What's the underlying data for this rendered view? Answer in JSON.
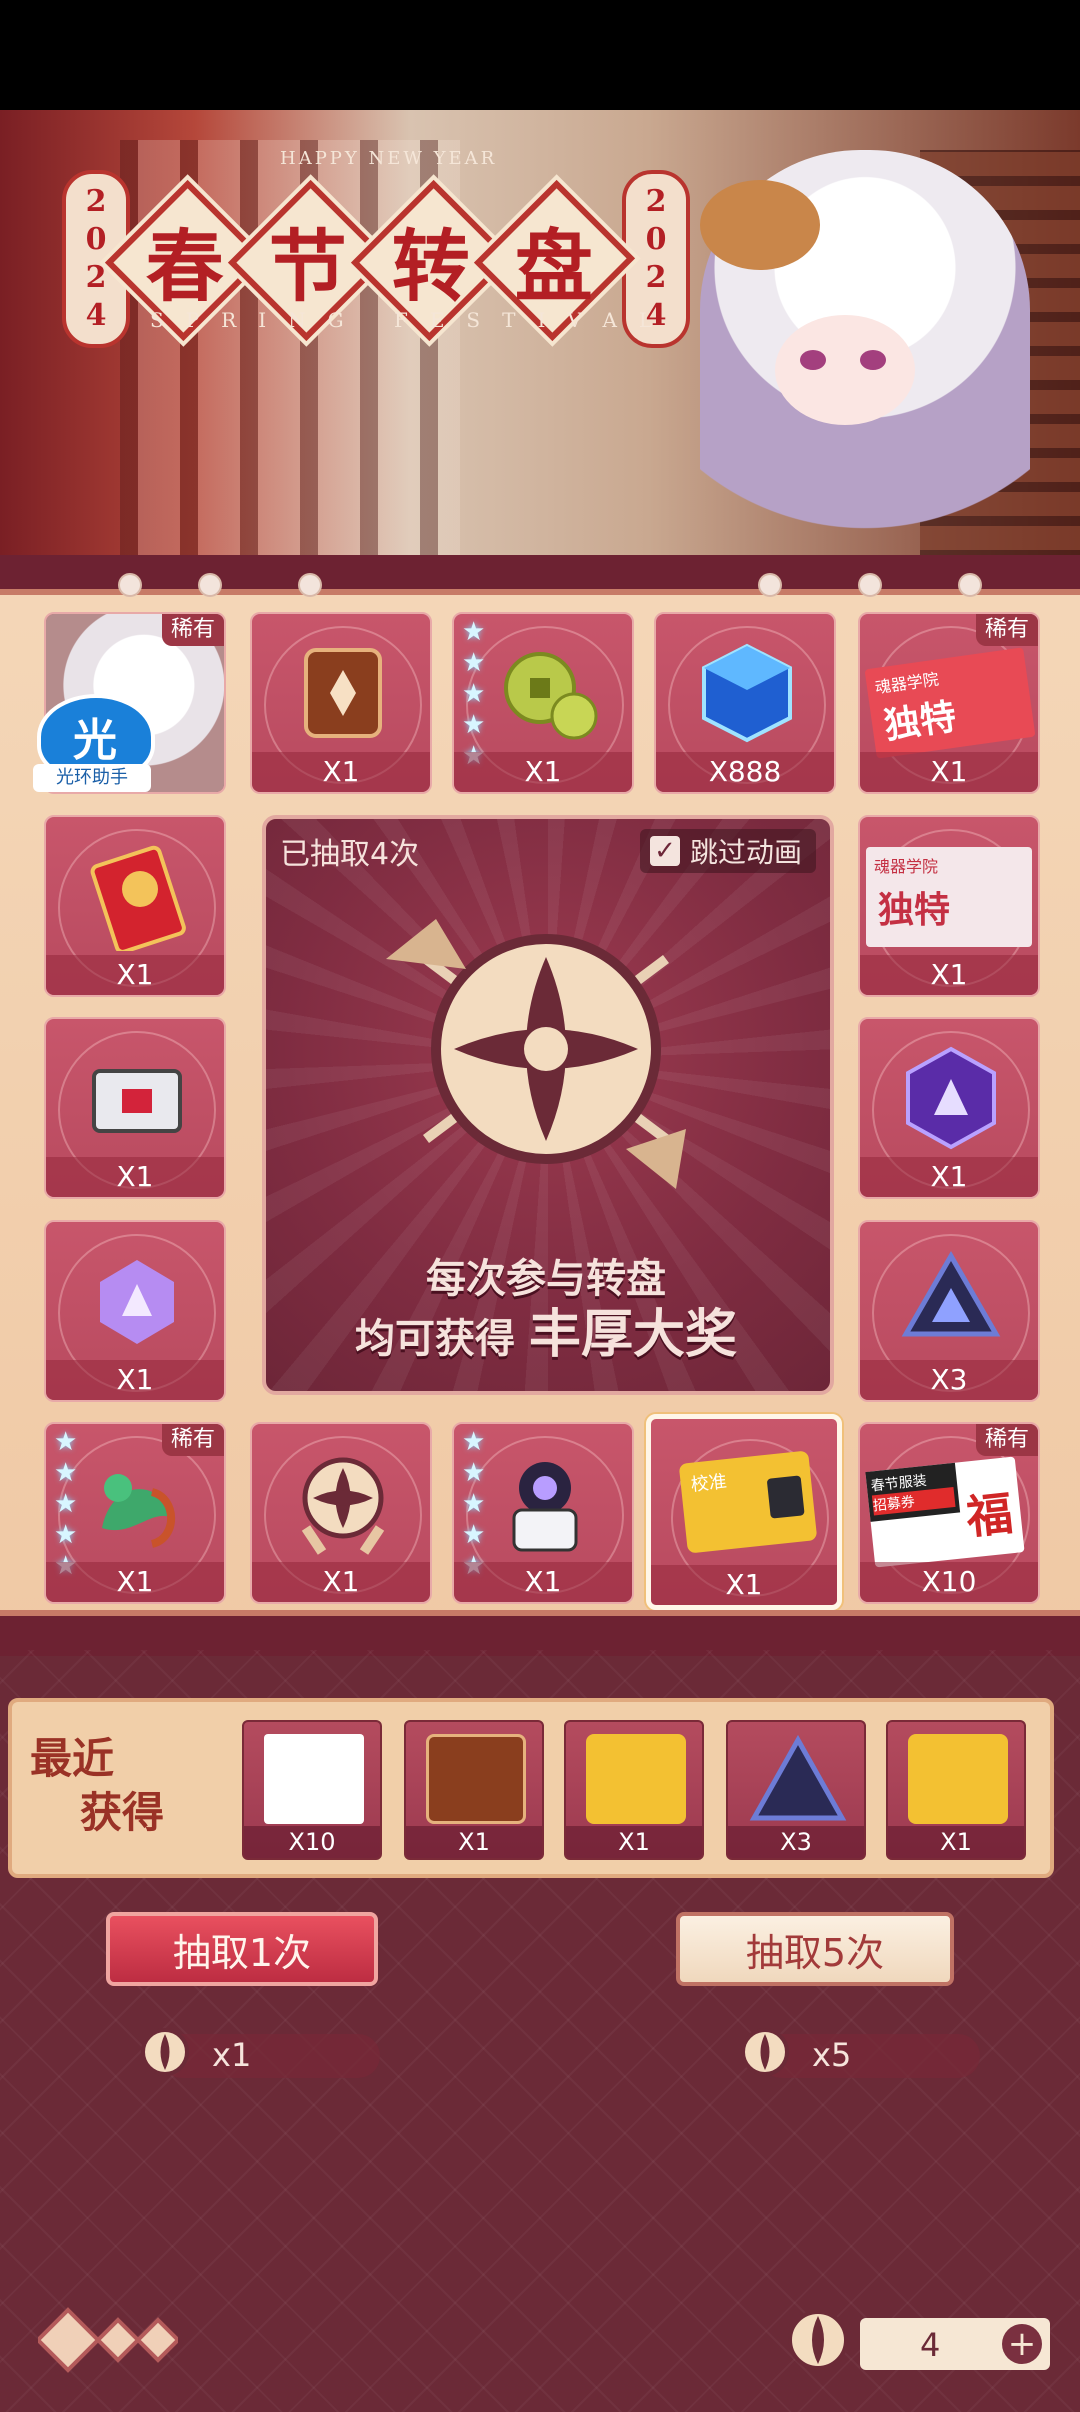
{
  "banner": {
    "title_chars": [
      "春",
      "节",
      "转",
      "盘"
    ],
    "year_left": [
      "2",
      "0",
      "2",
      "4"
    ],
    "year_right": [
      "2",
      "0",
      "2",
      "4"
    ],
    "happy_new_year": "HAPPY NEW YEAR",
    "spring_festival": "SPRING FESTIVAL"
  },
  "helper": {
    "glyph": "光",
    "label": "光环助手"
  },
  "grid": {
    "rare_label": "稀有",
    "cells": [
      {
        "id": "r1c1",
        "qty": "",
        "rare": true,
        "icon": "character-portrait"
      },
      {
        "id": "r1c2",
        "qty": "X1",
        "rare": false,
        "icon": "bronze-card"
      },
      {
        "id": "r1c3",
        "qty": "X1",
        "rare": false,
        "icon": "coins",
        "stars": 5
      },
      {
        "id": "r1c4",
        "qty": "X888",
        "rare": false,
        "icon": "blue-cube"
      },
      {
        "id": "r1c5",
        "qty": "X1",
        "rare": true,
        "icon": "red-ticket",
        "ticket_title": "独特",
        "ticket_sub": "魂器学院"
      },
      {
        "id": "r2c1",
        "qty": "X1",
        "rare": false,
        "icon": "red-envelope"
      },
      {
        "id": "r2c5",
        "qty": "X1",
        "rare": false,
        "icon": "red-ticket-2",
        "ticket_title": "独特",
        "ticket_sub": "魂器学院"
      },
      {
        "id": "r3c1",
        "qty": "X1",
        "rare": false,
        "icon": "chest"
      },
      {
        "id": "r3c5",
        "qty": "X1",
        "rare": false,
        "icon": "purple-hex"
      },
      {
        "id": "r4c1",
        "qty": "X1",
        "rare": false,
        "icon": "purple-crystal"
      },
      {
        "id": "r4c5",
        "qty": "X3",
        "rare": false,
        "icon": "dark-triangle"
      },
      {
        "id": "r5c1",
        "qty": "X1",
        "rare": true,
        "icon": "dragon",
        "stars": 5
      },
      {
        "id": "r5c2",
        "qty": "X1",
        "rare": false,
        "icon": "lucky-token"
      },
      {
        "id": "r5c3",
        "qty": "X1",
        "rare": false,
        "icon": "robot",
        "stars": 5
      },
      {
        "id": "r5c4",
        "qty": "X1",
        "rare": false,
        "icon": "yellow-chip",
        "selected": true,
        "chip_label": "校准"
      },
      {
        "id": "r5c5",
        "qty": "X10",
        "rare": true,
        "icon": "fu-coupon",
        "coupon_title": "春节服装",
        "coupon_sub": "招募券"
      }
    ]
  },
  "center": {
    "draw_count": "已抽取4次",
    "skip_animation": "跳过动画",
    "skip_checked": "✓",
    "slogan_line1": "每次参与转盘",
    "slogan_line2_a": "均可获得",
    "slogan_line2_b": "丰厚大奖"
  },
  "recent": {
    "label_line1": "最近",
    "label_line2": "获得",
    "items": [
      {
        "qty": "X10",
        "icon": "fu-coupon"
      },
      {
        "qty": "X1",
        "icon": "bronze-card"
      },
      {
        "qty": "X1",
        "icon": "yellow-chip"
      },
      {
        "qty": "X3",
        "icon": "dark-triangle"
      },
      {
        "qty": "X1",
        "icon": "yellow-chip"
      }
    ]
  },
  "actions": {
    "draw_once": "抽取1次",
    "draw_five": "抽取5次",
    "cost_once": "x1",
    "cost_five": "x5"
  },
  "footer": {
    "balance": "4",
    "plus": "+"
  },
  "colors": {
    "accent": "#c8566b",
    "panel": "#f1cfa9",
    "dark": "#6b2a37"
  }
}
